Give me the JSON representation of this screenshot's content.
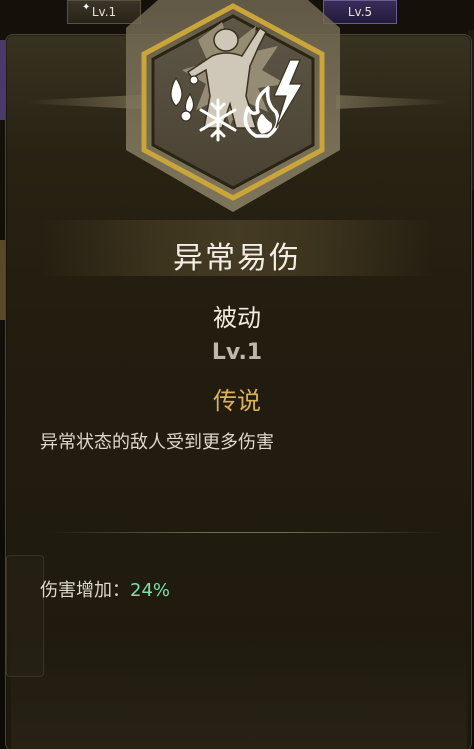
{
  "background_tiles": [
    {
      "level": "Lv.1"
    },
    {
      "level": "Lv.5"
    }
  ],
  "skill": {
    "name": "异常易伤",
    "type": "被动",
    "level": "Lv.1",
    "rarity": "传说",
    "description": "异常状态的敌人受到更多伤害",
    "stat_label": "伤害增加：",
    "stat_value": "24%"
  },
  "icons": {
    "emblem": "hexagon-emblem-icon",
    "figure": "humanoid-figure-icon",
    "water": "water-drop-icon",
    "ice": "snowflake-icon",
    "fire": "flame-icon",
    "lightning": "lightning-icon"
  },
  "colors": {
    "rarity": "#d9b25a",
    "stat_value": "#7ee0a8",
    "emblem_gold": "#c9a53a",
    "emblem_fill": "#8a7e66"
  }
}
